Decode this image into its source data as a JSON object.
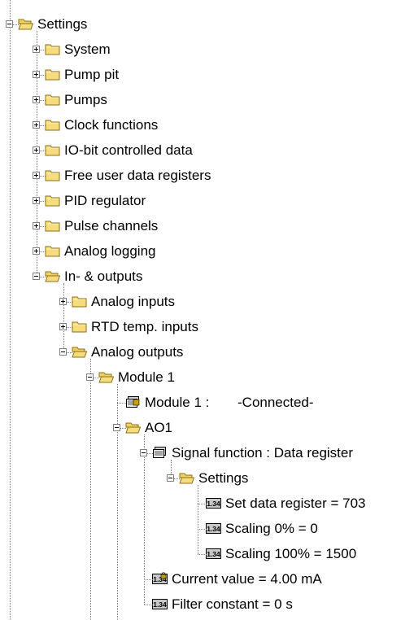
{
  "tree": {
    "root": {
      "label": "Settings",
      "expanded": true,
      "icon": "folder-open-icon"
    },
    "top_children": [
      {
        "label": "System",
        "expanded": false,
        "icon": "folder-icon"
      },
      {
        "label": "Pump pit",
        "expanded": false,
        "icon": "folder-icon"
      },
      {
        "label": "Pumps",
        "expanded": false,
        "icon": "folder-icon"
      },
      {
        "label": "Clock functions",
        "expanded": false,
        "icon": "folder-icon"
      },
      {
        "label": "IO-bit controlled data",
        "expanded": false,
        "icon": "folder-icon"
      },
      {
        "label": "Free user data registers",
        "expanded": false,
        "icon": "folder-icon"
      },
      {
        "label": "PID regulator",
        "expanded": false,
        "icon": "folder-icon"
      },
      {
        "label": "Pulse channels",
        "expanded": false,
        "icon": "folder-icon"
      },
      {
        "label": "Analog logging",
        "expanded": false,
        "icon": "folder-icon"
      },
      {
        "label": "In- & outputs",
        "expanded": true,
        "icon": "folder-open-icon"
      }
    ],
    "io_children": [
      {
        "label": "Analog inputs",
        "expanded": false,
        "icon": "folder-icon"
      },
      {
        "label": "RTD temp. inputs",
        "expanded": false,
        "icon": "folder-icon"
      },
      {
        "label": "Analog outputs",
        "expanded": true,
        "icon": "folder-open-icon"
      }
    ],
    "module1": {
      "label": "Module 1",
      "expanded": true,
      "icon": "folder-open-icon"
    },
    "module_status": {
      "label": "Module 1 :",
      "status": "-Connected-",
      "icon": "module-status-icon"
    },
    "ao1": {
      "label": "AO1",
      "expanded": true,
      "icon": "folder-open-icon"
    },
    "signal_function": {
      "label": "Signal function : Data register",
      "expanded": true,
      "icon": "signal-function-icon"
    },
    "settings_sub": {
      "label": "Settings",
      "expanded": true,
      "icon": "folder-open-icon"
    },
    "settings_values": [
      {
        "label": "Set data register = 703",
        "icon": "numeric-value-icon",
        "icon_text": "1.34"
      },
      {
        "label": "Scaling 0% = 0",
        "icon": "numeric-value-icon",
        "icon_text": "1.34"
      },
      {
        "label": "Scaling 100% = 1500",
        "icon": "numeric-value-icon",
        "icon_text": "1.34"
      }
    ],
    "current_value": {
      "label": "Current value = 4.00 mA",
      "icon": "locked-value-icon",
      "icon_text": "1.34"
    },
    "filter_constant": {
      "label": "Filter constant = 0 s",
      "icon": "numeric-value-icon",
      "icon_text": "1.34"
    }
  },
  "colors": {
    "folder_fill": "#f6dc7c",
    "folder_edge": "#8a7218",
    "tree_line": "#808080",
    "value_icon_bg": "#c8c8c8",
    "lock_color": "#c8a000"
  }
}
